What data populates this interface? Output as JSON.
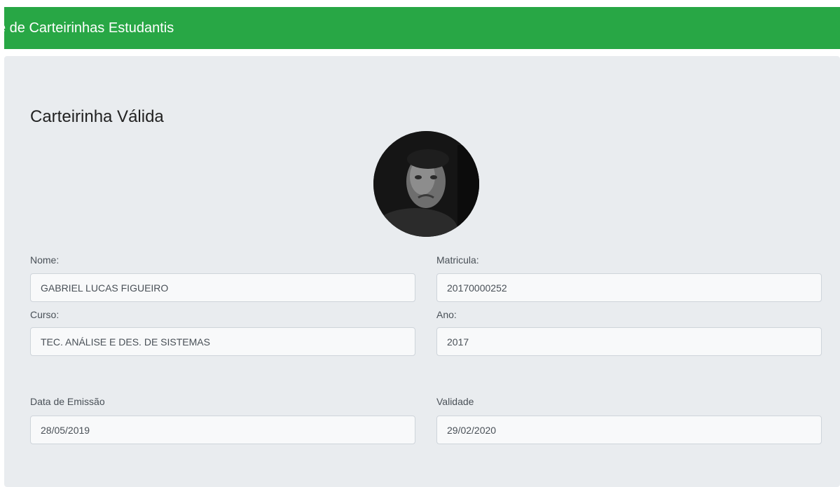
{
  "navbar": {
    "brand": "e de Carteirinhas Estudantis"
  },
  "card": {
    "title": "Carteirinha Válida",
    "avatar_icon": "student-photo"
  },
  "fields": {
    "nome": {
      "label": "Nome:",
      "value": "GABRIEL LUCAS FIGUEIRO"
    },
    "matricula": {
      "label": "Matricula:",
      "value": "20170000252"
    },
    "curso": {
      "label": "Curso:",
      "value": "TEC. ANÁLISE E DES. DE SISTEMAS"
    },
    "ano": {
      "label": "Ano:",
      "value": "2017"
    },
    "emissao": {
      "label": "Data de Emissão",
      "value": "28/05/2019"
    },
    "validade": {
      "label": "Validade",
      "value": "29/02/2020"
    }
  },
  "colors": {
    "navbar": "#28a745",
    "panel": "#e9ecef",
    "input_bg": "#f8f9fa"
  }
}
